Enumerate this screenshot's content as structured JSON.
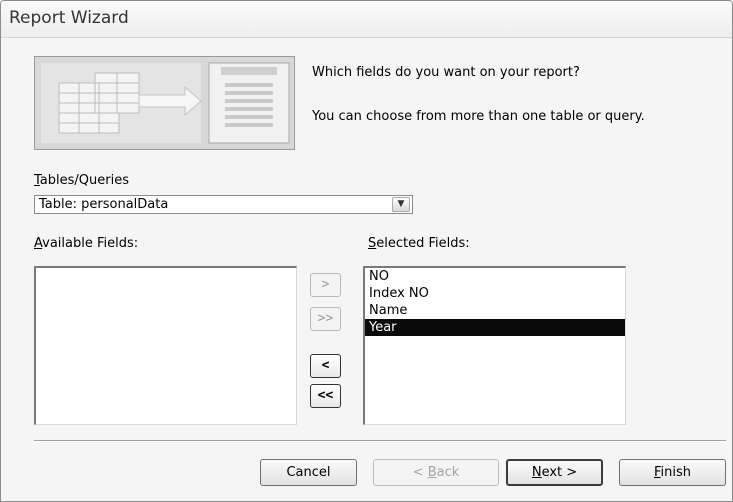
{
  "window": {
    "title": "Report Wizard"
  },
  "intro": {
    "question": "Which fields do you want on your report?",
    "hint": "You can choose from more than one table or query."
  },
  "tables_queries": {
    "label_accel": "T",
    "label_rest": "ables/Queries",
    "selected": "Table: personalData"
  },
  "available_fields": {
    "label_accel": "A",
    "label_rest": "vailable Fields:",
    "items": []
  },
  "selected_fields": {
    "label_accel": "S",
    "label_rest": "elected Fields:",
    "items": [
      "NO",
      "Index NO",
      "Name",
      "Year"
    ],
    "selected_item": "Year"
  },
  "move_buttons": {
    "add_one": ">",
    "add_all": ">>",
    "remove_one": "<",
    "remove_all": "<<"
  },
  "buttons": {
    "cancel": "Cancel",
    "back_accel": "B",
    "back_before": "< ",
    "back_after": "ack",
    "next_accel": "N",
    "next_after": "ext >",
    "finish_accel": "F",
    "finish_after": "inish"
  }
}
